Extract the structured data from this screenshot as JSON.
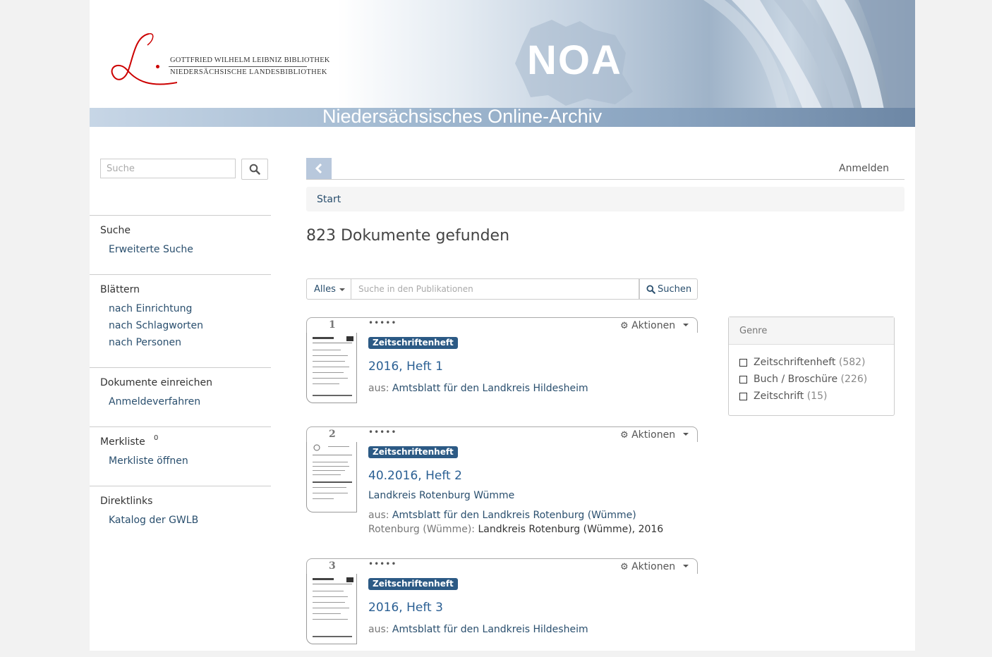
{
  "header": {
    "library_line1": "Gottfried Wilhelm Leibniz Bibliothek",
    "library_line2": "Niedersächsische Landesbibliothek",
    "logo_letter": "L",
    "brand": "NOA",
    "subtitle": "Niedersächsisches Online-Archiv"
  },
  "sidebar": {
    "search_placeholder": "Suche",
    "sections": [
      {
        "heading": "Suche",
        "links": [
          "Erweiterte Suche"
        ]
      },
      {
        "heading": "Blättern",
        "links": [
          "nach Einrichtung",
          "nach Schlagworten",
          "nach Personen"
        ]
      },
      {
        "heading": "Dokumente einreichen",
        "links": [
          "Anmeldeverfahren"
        ]
      },
      {
        "heading": "Merkliste",
        "count": "0",
        "links": [
          "Merkliste öffnen"
        ]
      },
      {
        "heading": "Direktlinks",
        "links": [
          "Katalog der GWLB"
        ]
      }
    ]
  },
  "topbar": {
    "login": "Anmelden"
  },
  "breadcrumb": {
    "start": "Start"
  },
  "results": {
    "count_text": "823 Dokumente gefunden",
    "scope_label": "Alles",
    "search_placeholder": "Suche in den Publikationen",
    "search_button": "Suchen",
    "actions_label": "Aktionen",
    "from_prefix": "aus:",
    "items": [
      {
        "num": "1",
        "dots": "•••••",
        "genre": "Zeitschriftenheft",
        "title": "2016, Heft 1",
        "from": "Amtsblatt für den Landkreis Hildesheim"
      },
      {
        "num": "2",
        "dots": "•••••",
        "genre": "Zeitschriftenheft",
        "title": "40.2016, Heft 2",
        "subtitle": "Landkreis Rotenburg Wümme",
        "from": "Amtsblatt für den Landkreis Rotenburg (Wümme)",
        "place": "Rotenburg (Wümme):",
        "publisher": "Landkreis Rotenburg (Wümme), 2016"
      },
      {
        "num": "3",
        "dots": "•••••",
        "genre": "Zeitschriftenheft",
        "title": "2016, Heft 3",
        "from": "Amtsblatt für den Landkreis Hildesheim"
      }
    ]
  },
  "facet": {
    "title": "Genre",
    "items": [
      {
        "label": "Zeitschriftenheft",
        "count": "(582)"
      },
      {
        "label": "Buch / Broschüre",
        "count": "(226)"
      },
      {
        "label": "Zeitschrift",
        "count": "(15)"
      }
    ]
  },
  "colors": {
    "link": "#2a4f6e",
    "title_link": "#2a5f93",
    "badge": "#2c5a85",
    "logo_red": "#cc0000"
  }
}
